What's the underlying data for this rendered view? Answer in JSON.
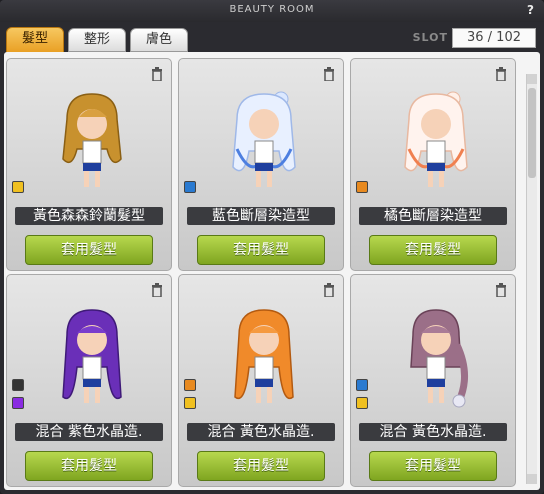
{
  "window": {
    "title": "BEAUTY ROOM",
    "help": "?"
  },
  "tabs": [
    {
      "label": "髮型",
      "active": true
    },
    {
      "label": "整形",
      "active": false
    },
    {
      "label": "膚色",
      "active": false
    }
  ],
  "slot": {
    "label": "SLOT",
    "value": "36 / 102"
  },
  "cards": [
    {
      "name": "黃色森森鈴蘭髮型",
      "button": "套用髮型",
      "hair": "golden-wavy",
      "dots": [
        "#f0c020"
      ]
    },
    {
      "name": "藍色斷層染造型",
      "button": "套用髮型",
      "hair": "blue-gradient-bun",
      "dots": [
        "#2a7ad0"
      ]
    },
    {
      "name": "橘色斷層染造型",
      "button": "套用髮型",
      "hair": "orange-gradient-bun",
      "dots": [
        "#e88a20"
      ]
    },
    {
      "name": "混合 紫色水晶造.",
      "button": "套用髮型",
      "hair": "purple-long",
      "dots": [
        "#333333",
        "#8a2be2"
      ]
    },
    {
      "name": "混合 黃色水晶造.",
      "button": "套用髮型",
      "hair": "orange-long",
      "dots": [
        "#e88a20",
        "#f0c020"
      ]
    },
    {
      "name": "混合 黃色水晶造.",
      "button": "套用髮型",
      "hair": "mauve-braid",
      "dots": [
        "#2a7ad0",
        "#f0c020"
      ]
    }
  ],
  "icons": {
    "trash": "trash-icon",
    "scroll": "scrollbar"
  },
  "colors": {
    "accent": "#e9a025",
    "button": "#8fb52a",
    "name_bg": "#3a3b3f"
  }
}
